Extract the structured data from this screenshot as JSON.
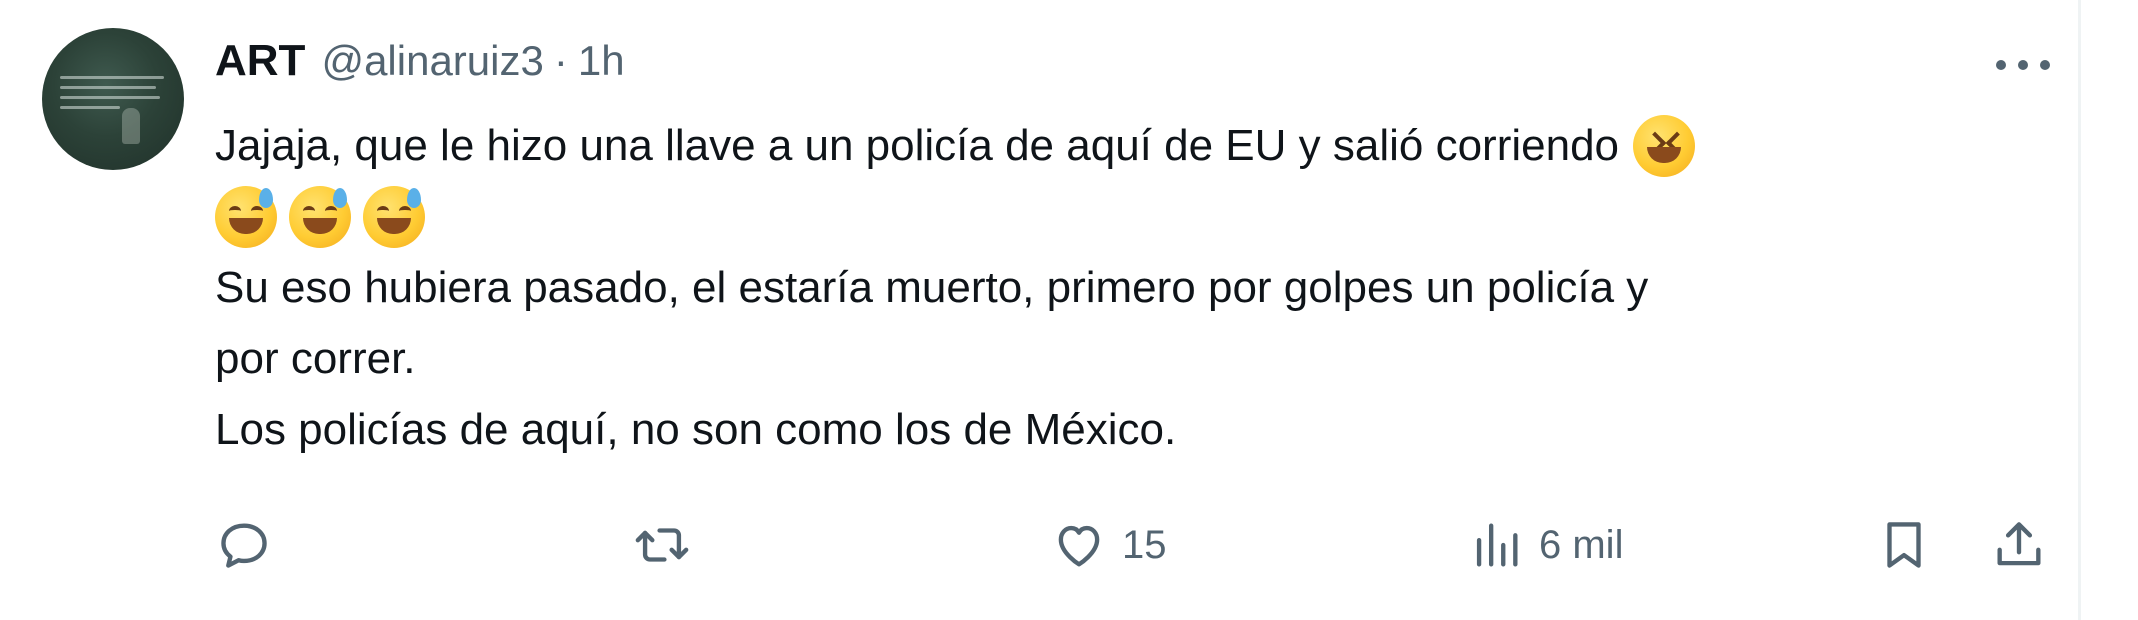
{
  "tweet": {
    "author_name": "ART",
    "handle": "@alinaruiz3",
    "separator": "·",
    "time": "1h",
    "text": {
      "line1": "Jajaja, que le hizo una llave a un policía de aquí de EU y salió corriendo",
      "line3": "Su eso hubiera pasado, el estaría muerto, primero por golpes un policía y",
      "line4": "por correr.",
      "line5": "Los policías de aquí, no son como los de México."
    },
    "emojis": [
      "laughing-squint-emoji",
      "sweat-smile-emoji",
      "sweat-smile-emoji",
      "sweat-smile-emoji"
    ]
  },
  "actions": {
    "reply": {
      "icon": "reply-icon",
      "count": ""
    },
    "retweet": {
      "icon": "retweet-icon",
      "count": ""
    },
    "like": {
      "icon": "heart-icon",
      "count": "15"
    },
    "views": {
      "icon": "views-icon",
      "count": "6 mil"
    },
    "bookmark": {
      "icon": "bookmark-icon"
    },
    "share": {
      "icon": "share-icon"
    }
  },
  "colors": {
    "text": "#0f1419",
    "secondary": "#536471",
    "emoji": "#ffcc33"
  }
}
